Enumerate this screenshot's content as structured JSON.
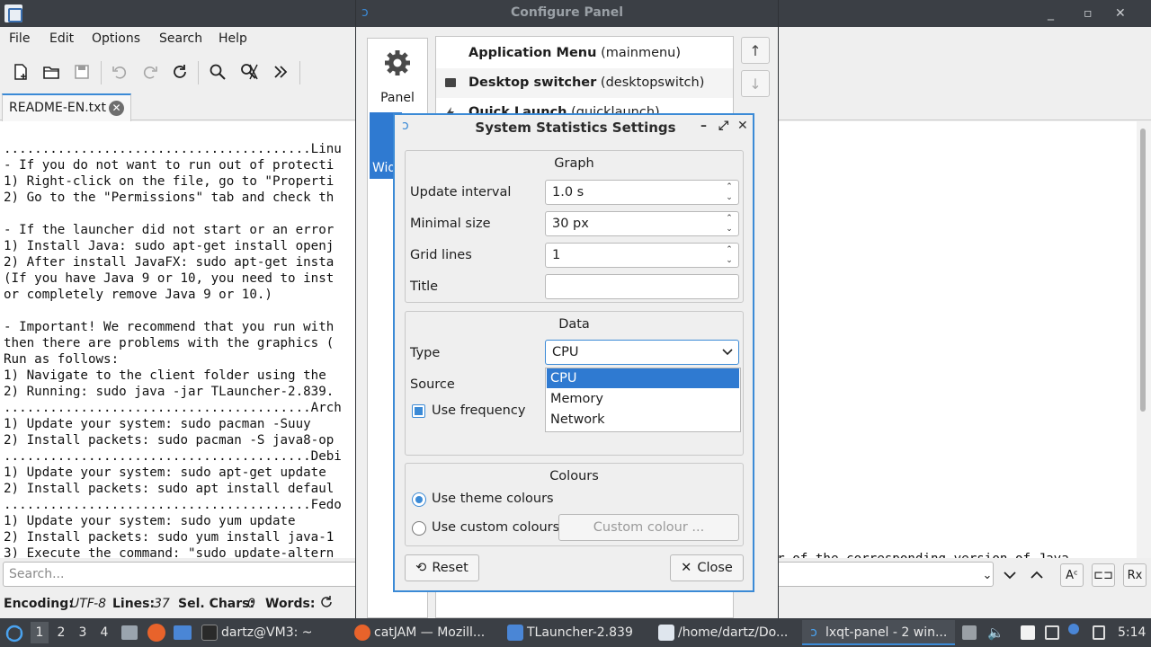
{
  "editor": {
    "menu": [
      "File",
      "Edit",
      "Options",
      "Search",
      "Help"
    ],
    "tab_label": "README-EN.txt",
    "text_lines": [
      "........................................Linu",
      "- If you do not want to run out of protecti",
      "1) Right-click on the file, go to \"Properti",
      "2) Go to the \"Permissions\" tab and check th",
      "",
      "- If the launcher did not start or an error",
      "1) Install Java: sudo apt-get install openj",
      "2) After install JavaFX: sudo apt-get insta",
      "(If you have Java 9 or 10, you need to inst",
      "or completely remove Java 9 or 10.)",
      "",
      "- Important! We recommend that you run with",
      "then there are problems with the graphics (",
      "Run as follows:",
      "1) Navigate to the client folder using the ",
      "2) Running: sudo java -jar TLauncher-2.839.",
      "........................................Arch",
      "1) Update your system: sudo pacman -Suuy",
      "2) Install packets: sudo pacman -S java8-op",
      "........................................Debi",
      "1) Update your system: sudo apt-get update",
      "2) Install packets: sudo apt install defaul",
      "........................................Fedo",
      "1) Update your system: sudo yum update",
      "2) Install packets: sudo yum install java-1",
      "3) Execute the command: \"sudo update-altern"
    ],
    "text_tail": "umber of the corresponding version of Java",
    "search_placeholder": "Search...",
    "status": {
      "encoding_label": "Encoding:",
      "encoding_value": "UTF-8",
      "lines_label": "Lines:",
      "lines_value": "37",
      "sel_label": "Sel. Chars:",
      "sel_value": "0",
      "words_label": "Words:"
    }
  },
  "configure_panel": {
    "title": "Configure Panel",
    "side_panel_label": "Panel",
    "side_widgets_label": "Wid",
    "plugins": [
      {
        "name": "Application Menu",
        "id": "(mainmenu)"
      },
      {
        "name": "Desktop switcher",
        "id": "(desktopswitch)"
      },
      {
        "name": "Quick Launch",
        "id": "(quicklaunch)"
      }
    ]
  },
  "dialog": {
    "title": "System Statistics Settings",
    "graph": {
      "title": "Graph",
      "update_interval_label": "Update interval",
      "update_interval_value": "1.0 s",
      "minimal_size_label": "Minimal size",
      "minimal_size_value": "30 px",
      "grid_lines_label": "Grid lines",
      "grid_lines_value": "1",
      "title_label": "Title",
      "title_value": ""
    },
    "data": {
      "title": "Data",
      "type_label": "Type",
      "type_value": "CPU",
      "type_options": [
        "CPU",
        "Memory",
        "Network"
      ],
      "source_label": "Source",
      "use_frequency_label": "Use frequency"
    },
    "colours": {
      "title": "Colours",
      "theme_label": "Use theme colours",
      "custom_label": "Use custom colours",
      "custom_button": "Custom colour ..."
    },
    "reset_button": "Reset",
    "close_button": "Close"
  },
  "taskbar": {
    "workspaces": [
      "1",
      "2",
      "3",
      "4"
    ],
    "tasks": [
      "dartz@VM3: ~",
      "catJAM — Mozill...",
      "TLauncher-2.839",
      "/home/dartz/Do...",
      "lxqt-panel - 2 win..."
    ],
    "clock": "5:14"
  },
  "colors": {
    "accent": "#3b8ad6",
    "selection": "#2f7ad1",
    "titlebar": "#3b3f45"
  }
}
